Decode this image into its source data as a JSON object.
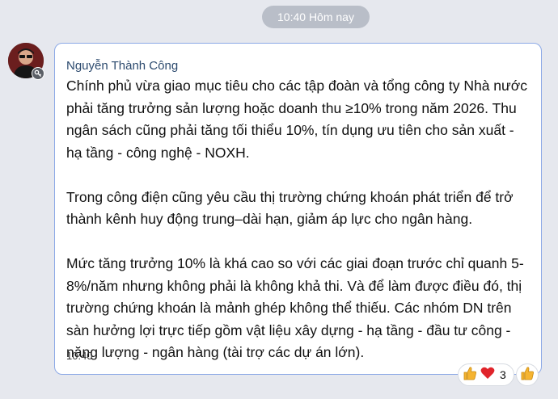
{
  "date_separator": "10:40 Hôm nay",
  "message": {
    "sender": "Nguyễn Thành Công",
    "paragraphs": [
      "Chính phủ vừa giao mục tiêu cho các tập đoàn và tổng công ty Nhà nước phải tăng trưởng sản lượng hoặc doanh thu ≥10% trong năm 2026. Thu ngân sách cũng phải tăng tối thiểu 10%, tín dụng ưu tiên cho sản xuất - hạ tầng - công nghệ - NOXH.",
      "Trong công điện cũng yêu cầu thị trường chứng khoán phát triển để trở thành kênh huy động trung–dài hạn, giảm áp lực cho ngân hàng.",
      "Mức tăng trưởng 10% là khá cao so với các giai đoạn trước chỉ quanh 5-8%/năm nhưng không phải là không khả thi. Và để làm được điều đó, thị trường chứng khoán là mảnh ghép không thể thiếu. Các nhóm DN trên sàn hưởng lợi trực tiếp gồm vật liệu xây dựng - hạ tầng - đầu tư công - năng lượng - ngân hàng (tài trợ các dự án lớn)."
    ],
    "time": "10:40",
    "reactions": {
      "icons": [
        "thumbs-up-icon",
        "heart-icon"
      ],
      "count": "3"
    }
  },
  "colors": {
    "bubble_border": "#8ca9e6",
    "sender_name": "#2c4a6e",
    "heart": "#e0242b",
    "thumb": "#f5b431"
  }
}
